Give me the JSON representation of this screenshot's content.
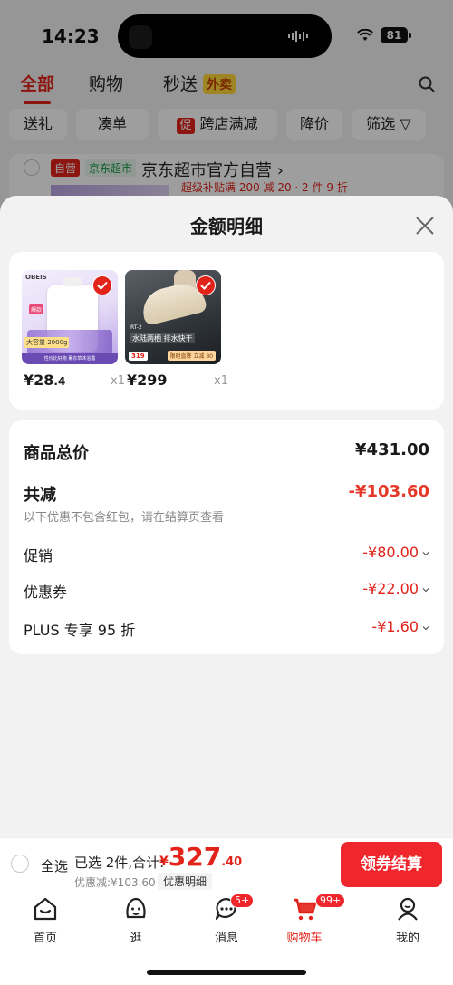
{
  "status_bar": {
    "time": "14:23",
    "battery": "81"
  },
  "top_tabs": {
    "all": "全部",
    "shopping": "购物",
    "fast": "秒送",
    "waimai": "外卖"
  },
  "filter_chips": [
    "送礼",
    "凑单",
    "跨店满减",
    "降价",
    "筛选"
  ],
  "filter_chip_promo_tag": "促",
  "store": {
    "tag_self": "自营",
    "tag_jd": "京东超市",
    "name": "京东超市官方自营",
    "promo": "超级补贴满 200 减 20 · 2 件 9 折"
  },
  "sheet": {
    "title": "金额明细",
    "products": [
      {
        "price_main": "¥28",
        "price_cents": ".4",
        "qty": "x1",
        "brand": "OBEIS",
        "badge": "大容量 2000g",
        "strip": "性价比好物 薰衣草沐浴露",
        "tag": "爆款"
      },
      {
        "price_main": "¥299",
        "price_cents": "",
        "qty": "x1",
        "model": "RT-2",
        "line": "水陆两栖 排水快干",
        "price_tag": "319",
        "cta": "限时直降 立减 80"
      }
    ],
    "rows": {
      "total_label": "商品总价",
      "total_value": "¥431.00",
      "reduce_label": "共减",
      "reduce_value": "-¥103.60",
      "note": "以下优惠不包含红包，请在结算页查看",
      "promo_label": "促销",
      "promo_value": "-¥80.00",
      "coupon_label": "优惠券",
      "coupon_value": "-¥22.00",
      "plus_label": "PLUS 专享 95 折",
      "plus_value": "-¥1.60"
    }
  },
  "checkout": {
    "select_all": "全选",
    "summary": "已选 2件,合计:",
    "yen": "¥",
    "amount_int": "327",
    "amount_dec": ".40",
    "discount": "优惠减:¥103.60",
    "detail_pill": "优惠明细",
    "cta": "领券结算"
  },
  "tabbar": {
    "home": "首页",
    "browse": "逛",
    "messages": "消息",
    "messages_badge": "5+",
    "cart": "购物车",
    "cart_badge": "99+",
    "me": "我的"
  },
  "colors": {
    "accent": "#e2231a",
    "cta": "#f0262d"
  }
}
